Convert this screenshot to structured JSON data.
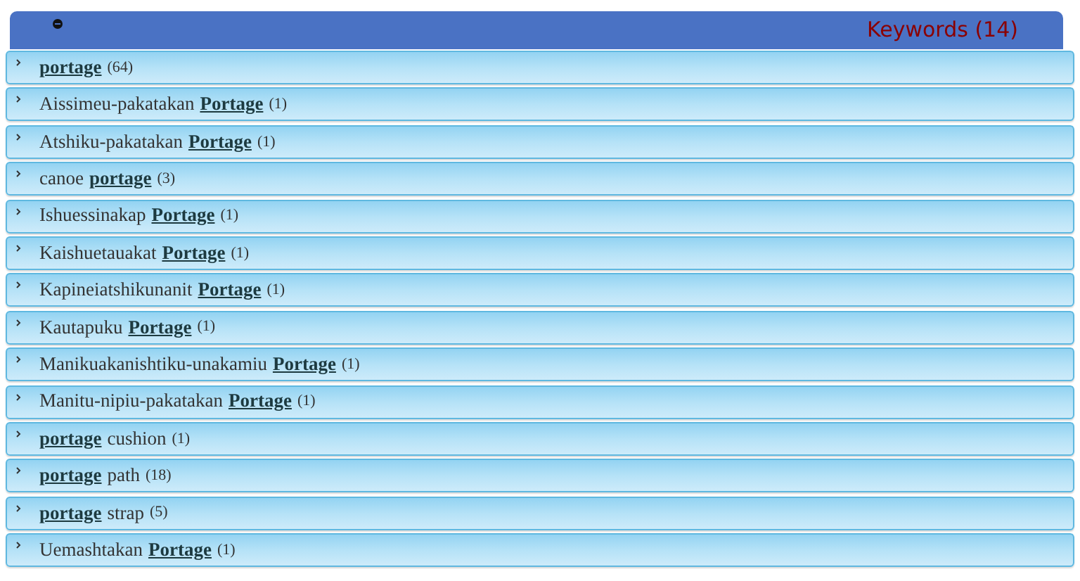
{
  "header": {
    "title": "Keywords (14)"
  },
  "keywords": [
    {
      "link": "portage",
      "count": "(64)"
    },
    {
      "before": "Aissimeu-pakatakan",
      "link": "Portage",
      "count": "(1)"
    },
    {
      "before": "Atshiku-pakatakan",
      "link": "Portage",
      "count": "(1)"
    },
    {
      "before": "canoe",
      "link": "portage",
      "count": "(3)"
    },
    {
      "before": "Ishuessinakap",
      "link": "Portage",
      "count": "(1)"
    },
    {
      "before": "Kaishuetauakat",
      "link": "Portage",
      "count": "(1)"
    },
    {
      "before": "Kapineiatshikunanit",
      "link": "Portage",
      "count": "(1)"
    },
    {
      "before": "Kautapuku",
      "link": "Portage",
      "count": "(1)"
    },
    {
      "before": "Manikuakanishtiku-unakamiu",
      "link": "Portage",
      "count": "(1)"
    },
    {
      "before": "Manitu-nipiu-pakatakan",
      "link": "Portage",
      "count": "(1)"
    },
    {
      "link": "portage",
      "after": "cushion",
      "count": "(1)"
    },
    {
      "link": "portage",
      "after": "path",
      "count": "(18)"
    },
    {
      "link": "portage",
      "after": "strap",
      "count": "(5)"
    },
    {
      "before": "Uemashtakan",
      "link": "Portage",
      "count": "(1)"
    }
  ]
}
